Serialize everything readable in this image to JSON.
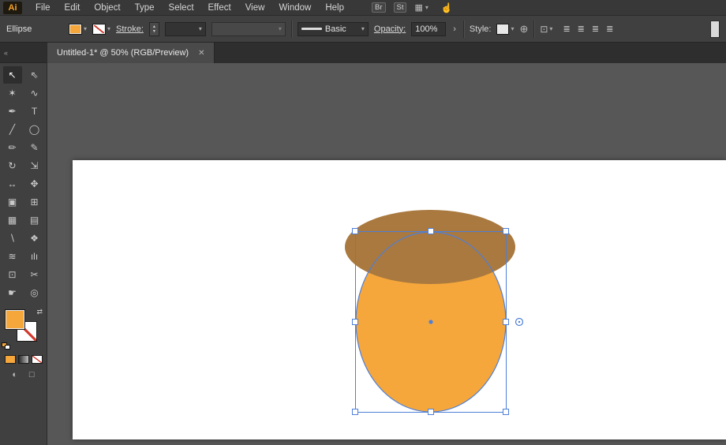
{
  "app": {
    "name": "Adobe Illustrator"
  },
  "menubar": {
    "logo": "Ai",
    "items": [
      "File",
      "Edit",
      "Object",
      "Type",
      "Select",
      "Effect",
      "View",
      "Window",
      "Help"
    ],
    "bridge": "Br",
    "stock": "St"
  },
  "controlbar": {
    "tool_label": "Ellipse",
    "stroke_label": "Stroke:",
    "profile_label": "Basic",
    "opacity_label": "Opacity:",
    "opacity_value": "100%",
    "style_label": "Style:"
  },
  "tab": {
    "title": "Untitled-1* @ 50% (RGB/Preview)"
  },
  "toolbar": {
    "tools": [
      {
        "name": "selection",
        "glyph": "↖"
      },
      {
        "name": "direct-selection",
        "glyph": "⇖"
      },
      {
        "name": "magic-wand",
        "glyph": "✶"
      },
      {
        "name": "lasso",
        "glyph": "∿"
      },
      {
        "name": "pen",
        "glyph": "✒"
      },
      {
        "name": "type",
        "glyph": "T"
      },
      {
        "name": "line-segment",
        "glyph": "╱"
      },
      {
        "name": "ellipse",
        "glyph": "◯"
      },
      {
        "name": "paintbrush",
        "glyph": "✏"
      },
      {
        "name": "pencil",
        "glyph": "✎"
      },
      {
        "name": "rotate",
        "glyph": "↻"
      },
      {
        "name": "scale",
        "glyph": "⇲"
      },
      {
        "name": "width",
        "glyph": "↔"
      },
      {
        "name": "free-transform",
        "glyph": "✥"
      },
      {
        "name": "shape-builder",
        "glyph": "▣"
      },
      {
        "name": "perspective-grid",
        "glyph": "⊞"
      },
      {
        "name": "mesh",
        "glyph": "▦"
      },
      {
        "name": "gradient",
        "glyph": "▤"
      },
      {
        "name": "eyedropper",
        "glyph": "∖"
      },
      {
        "name": "blend",
        "glyph": "❖"
      },
      {
        "name": "symbol-sprayer",
        "glyph": "≋"
      },
      {
        "name": "column-graph",
        "glyph": "ılı"
      },
      {
        "name": "artboard",
        "glyph": "⊡"
      },
      {
        "name": "slice",
        "glyph": "✂"
      },
      {
        "name": "hand",
        "glyph": "☛"
      },
      {
        "name": "zoom",
        "glyph": "◎"
      }
    ]
  },
  "artwork": {
    "canvas_color": "#575757",
    "artboard_color": "#ffffff",
    "body_color": "#F5A73B",
    "cap_color": "#A9793F",
    "selection_color": "#4E7FD9",
    "handle_fill": "#ffffff"
  },
  "icons": {
    "chevron": "▾",
    "close": "✕",
    "swap": "⇄",
    "step_up": "▴",
    "step_down": "▾",
    "more": "›",
    "globe": "⊕",
    "workspace": "▦",
    "touch": "☝",
    "align": "≣",
    "transform": "⊡",
    "collapse": "«",
    "draw_mode": "◐",
    "screen_mode": "□"
  }
}
